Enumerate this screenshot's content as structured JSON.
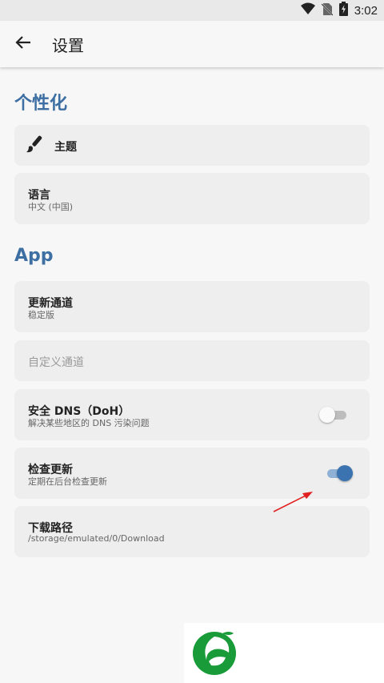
{
  "status_bar": {
    "time": "3:02",
    "icons": [
      "wifi-icon",
      "no-sim-icon",
      "battery-charging-icon"
    ]
  },
  "app_bar": {
    "title": "设置",
    "back_icon": "arrow-left-icon"
  },
  "sections": {
    "personalization": {
      "header": "个性化",
      "theme": {
        "label": "主题",
        "icon": "paintbrush-icon"
      },
      "language": {
        "label": "语言",
        "value": "中文 (中国)"
      }
    },
    "app": {
      "header": "App",
      "update_channel": {
        "label": "更新通道",
        "value": "稳定版"
      },
      "custom_channel": {
        "label": "自定义通道"
      },
      "secure_dns": {
        "label": "安全 DNS（DoH）",
        "description": "解决某些地区的 DNS 污染问题",
        "enabled": false
      },
      "check_updates": {
        "label": "检查更新",
        "description": "定期在后台检查更新",
        "enabled": true
      },
      "download_path": {
        "label": "下载路径",
        "value": "/storage/emulated/0/Download"
      }
    }
  },
  "colors": {
    "accent": "#3d6fa3",
    "toggle_on_thumb": "#3b73b0",
    "toggle_on_track": "#8fb1d6",
    "toggle_off_thumb": "#fafafa",
    "toggle_off_track": "#bdbdbd",
    "annotation_arrow": "#e02020",
    "logo_green": "#1a9b3a"
  }
}
